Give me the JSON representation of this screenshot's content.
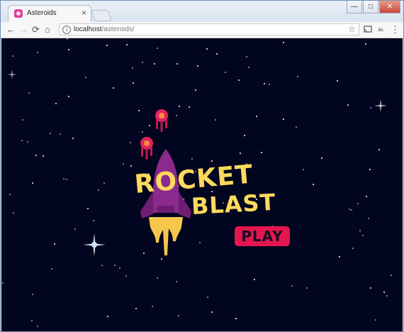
{
  "tab": {
    "title": "Asteroids",
    "close": "×"
  },
  "window": {
    "minimize": "—",
    "maximize": "□",
    "close": "✕"
  },
  "toolbar": {
    "back": "←",
    "forward": "→",
    "reload": "⟳",
    "home": "⌂",
    "info": "i",
    "star": "☆",
    "menu": "⋮"
  },
  "address": {
    "host": "localhost",
    "path": "/asteroids/"
  },
  "game": {
    "title_line1": "ROCKET",
    "title_line2": "BLAST",
    "play_label": "PLAY",
    "colors": {
      "background": "#02051f",
      "title": "#ffd95c",
      "button": "#e3164f",
      "rocket": "#8a2a8c",
      "flame": "#f6c64b",
      "enemy": "#e0245e"
    }
  }
}
